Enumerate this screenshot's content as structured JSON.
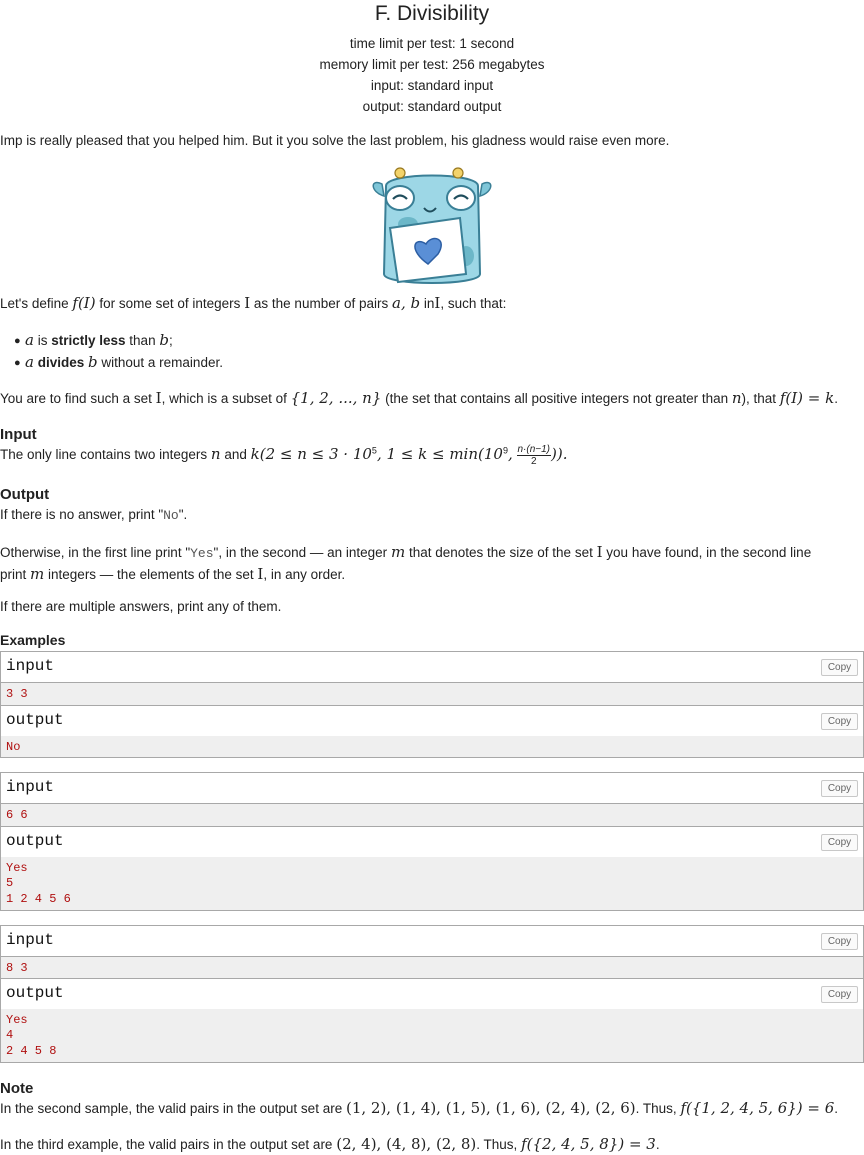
{
  "header": {
    "title": "F. Divisibility",
    "time_limit": "time limit per test: 1 second",
    "memory_limit": "memory limit per test: 256 megabytes",
    "input": "input: standard input",
    "output": "output: standard output"
  },
  "statement": {
    "intro": "Imp is really pleased that you helped him. But it you solve the last problem, his gladness would raise even more.",
    "define_1": "Let's define",
    "define_f": "f(I)",
    "define_2": "for some set of integers",
    "define_I": "I",
    "define_3": "as the number of pairs",
    "define_ab": "a, b",
    "define_4": "in",
    "define_I2": "I",
    "define_5": ", such that:",
    "bullet1_a": "a",
    "bullet1_is": "is",
    "bullet1_bold": "strictly less",
    "bullet1_than": "than",
    "bullet1_b": "b",
    "bullet1_end": ";",
    "bullet2_a": "a",
    "bullet2_bold": "divides",
    "bullet2_b": "b",
    "bullet2_end": "without a remainder.",
    "task_1": "You are to find such a set",
    "task_I": "I",
    "task_2": ", which is a subset of",
    "task_set": "{1, 2, ..., n}",
    "task_3": "(the set that contains all positive integers not greater than",
    "task_n": "n",
    "task_4": "), that",
    "task_eq": "f(I) = k",
    "task_5": "."
  },
  "input_section": {
    "heading": "Input",
    "text_1": "The only line contains two integers",
    "n": "n",
    "and": "and",
    "k": "k",
    "constraint_a": "(2 ≤ n ≤ 3 · 10",
    "exp5": "5",
    "constraint_b": ", 1 ≤ k ≤ min(10",
    "exp9": "9",
    "constraint_c": ",",
    "frac_num": "n·(n−1)",
    "frac_den": "2",
    "constraint_d": ")).",
    "dot": ""
  },
  "output_section": {
    "heading": "Output",
    "line1_a": "If there is no answer, print \"",
    "line1_code": "No",
    "line1_b": "\".",
    "line2_a": "Otherwise, in the first line print \"",
    "line2_code": "Yes",
    "line2_b": "\", in the second — an integer",
    "line2_m": "m",
    "line2_c": "that denotes the size of the set",
    "line2_I": "I",
    "line2_d": "you have found, in the second line",
    "line3_a": "print",
    "line3_m": "m",
    "line3_b": "integers — the elements of the set",
    "line3_I": "I",
    "line3_c": ", in any order.",
    "line4": "If there are multiple answers, print any of them."
  },
  "examples": {
    "heading": "Examples",
    "copy_label": "Copy",
    "input_label": "input",
    "output_label": "output",
    "cases": [
      {
        "input": [
          "3 3"
        ],
        "output": [
          "No"
        ]
      },
      {
        "input": [
          "6 6"
        ],
        "output": [
          "Yes",
          "5",
          "1 2 4 5 6"
        ]
      },
      {
        "input": [
          "8 3"
        ],
        "output": [
          "Yes",
          "4",
          "2 4 5 8"
        ]
      }
    ]
  },
  "note": {
    "heading": "Note",
    "line1_a": "In the second sample, the valid pairs in the output set are",
    "line1_pairs": "(1, 2), (1, 4), (1, 5), (1, 6), (2, 4), (2, 6)",
    "line1_b": ". Thus,",
    "line1_eq": "f({1, 2, 4, 5, 6}) = 6",
    "line1_c": ".",
    "line2_a": "In the third example, the valid pairs in the output set are",
    "line2_pairs": "(2, 4), (4, 8), (2, 8)",
    "line2_b": ". Thus,",
    "line2_eq": "f({2, 4, 5, 8}) = 3",
    "line2_c": "."
  }
}
